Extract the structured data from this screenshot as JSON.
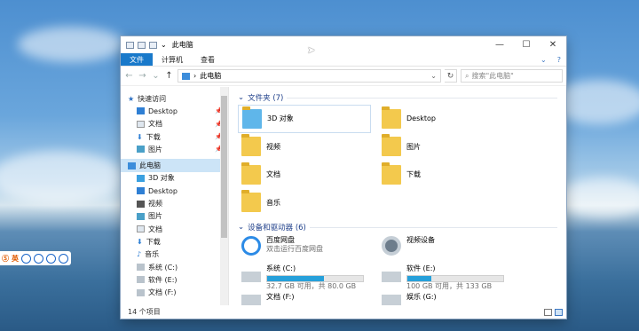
{
  "window": {
    "title": "此电脑",
    "controls": {
      "minimize": "—",
      "maximize": "☐",
      "close": "✕"
    }
  },
  "ribbon": {
    "tabs": [
      "文件",
      "计算机",
      "查看"
    ],
    "expand": "⌄",
    "help": "?"
  },
  "address": {
    "back": "←",
    "forward": "→",
    "up": "↑",
    "path": "此电脑",
    "search_placeholder": "搜索\"此电脑\""
  },
  "ime": {
    "label": "英"
  },
  "sidebar": {
    "quick_access": "快速访问",
    "items": [
      {
        "label": "Desktop",
        "pinned": true
      },
      {
        "label": "文档",
        "pinned": true
      },
      {
        "label": "下载",
        "pinned": true
      },
      {
        "label": "图片",
        "pinned": true
      }
    ],
    "this_pc": "此电脑",
    "pc_items": [
      "3D 对象",
      "Desktop",
      "视频",
      "图片",
      "文档",
      "下载",
      "音乐",
      "系统 (C:)",
      "软件 (E:)",
      "文档 (F:)"
    ]
  },
  "content": {
    "folders_header": "文件夹 (7)",
    "folders": [
      "3D 对象",
      "Desktop",
      "视频",
      "图片",
      "文档",
      "下载",
      "音乐"
    ],
    "devices_header": "设备和驱动器 (6)",
    "devices": [
      {
        "name": "百度网盘",
        "sub": "双击运行百度网盘"
      },
      {
        "name": "视频设备",
        "sub": ""
      }
    ],
    "drives": [
      {
        "name": "系统 (C:)",
        "info": "32.7 GB 可用，共 80.0 GB",
        "used_fraction": 0.59
      },
      {
        "name": "软件 (E:)",
        "info": "100 GB 可用，共 133 GB",
        "used_fraction": 0.25
      },
      {
        "name": "文档 (F:)",
        "info": ""
      },
      {
        "name": "娱乐 (G:)",
        "info": ""
      }
    ]
  },
  "status": {
    "count": "14 个项目"
  },
  "colors": {
    "accent": "#1979ca",
    "bar": "#26a0da",
    "folder": "#f3c94d"
  }
}
